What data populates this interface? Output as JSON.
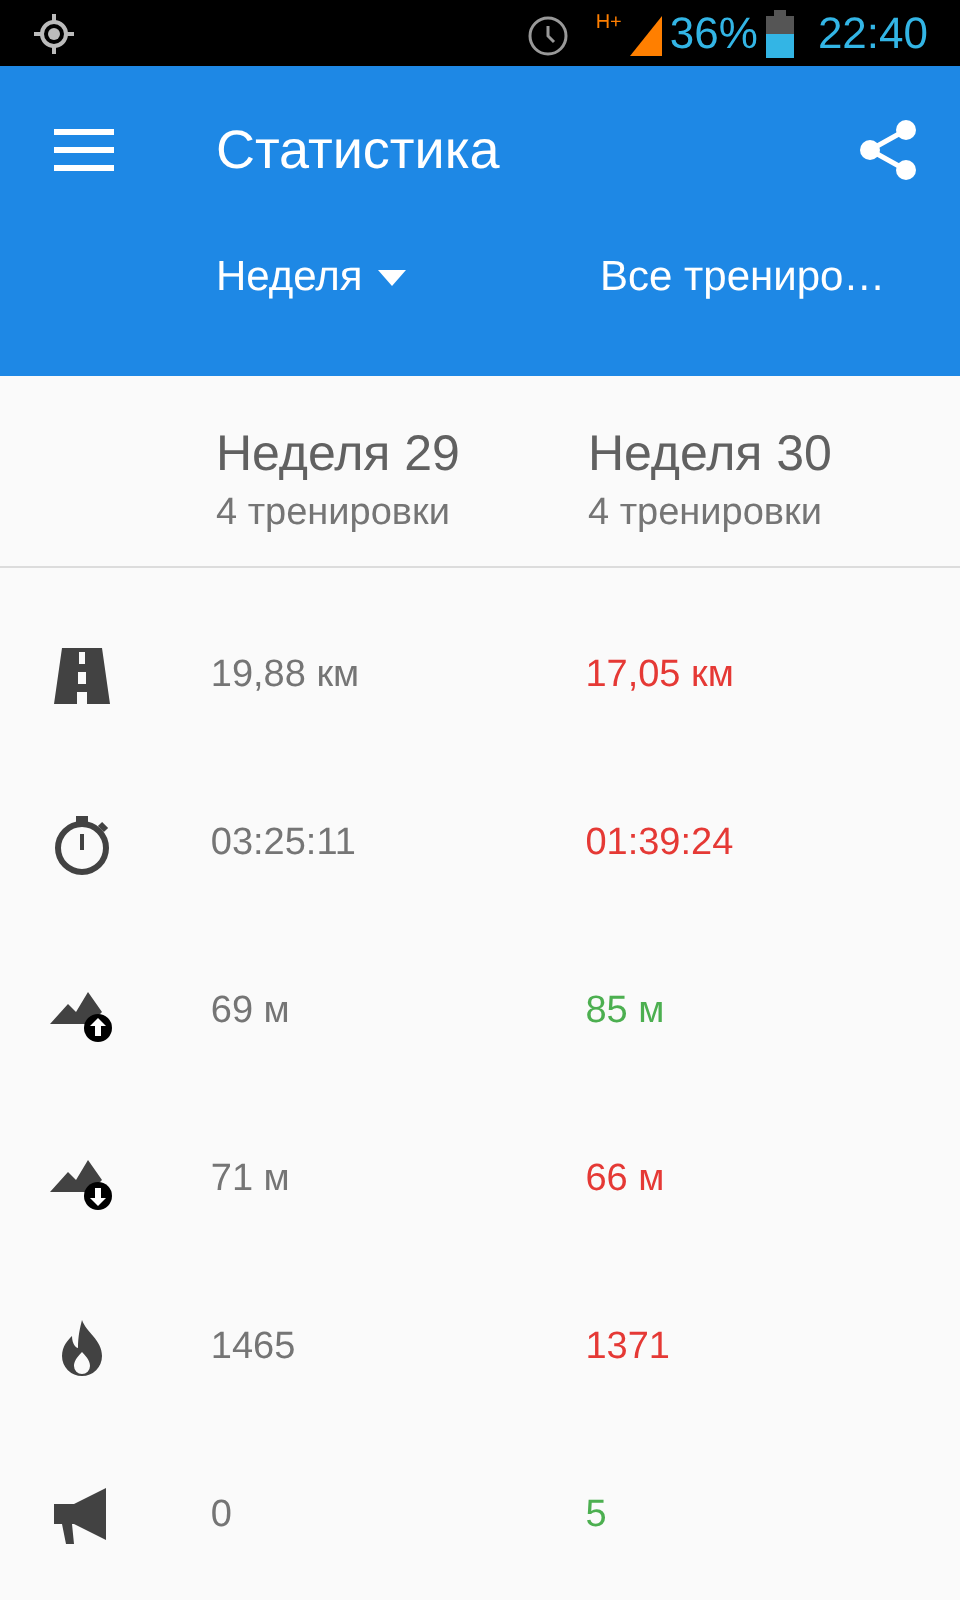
{
  "status_bar": {
    "battery_text": "36%",
    "network": "H+",
    "time": "22:40"
  },
  "app_bar": {
    "title": "Статистика"
  },
  "filters": [
    {
      "label": "Неделя",
      "dropdown": true
    },
    {
      "label": "Все трениро…",
      "dropdown": false
    }
  ],
  "columns": [
    {
      "title": "Неделя 29",
      "subtitle": "4 тренировки"
    },
    {
      "title": "Неделя 30",
      "subtitle": "4 тренировки"
    }
  ],
  "rows": [
    {
      "kind": "distance",
      "values": [
        {
          "text": "19,88 км",
          "color": "#757575"
        },
        {
          "text": "17,05 км",
          "color": "#e53935"
        }
      ]
    },
    {
      "kind": "duration",
      "values": [
        {
          "text": "03:25:11",
          "color": "#757575"
        },
        {
          "text": "01:39:24",
          "color": "#e53935"
        }
      ]
    },
    {
      "kind": "ascent",
      "values": [
        {
          "text": "69 м",
          "color": "#757575"
        },
        {
          "text": "85 м",
          "color": "#4caf50"
        }
      ]
    },
    {
      "kind": "descent",
      "values": [
        {
          "text": "71 м",
          "color": "#757575"
        },
        {
          "text": "66 м",
          "color": "#e53935"
        }
      ]
    },
    {
      "kind": "calories",
      "values": [
        {
          "text": "1465",
          "color": "#757575"
        },
        {
          "text": "1371",
          "color": "#e53935"
        }
      ]
    },
    {
      "kind": "cheers",
      "values": [
        {
          "text": "0",
          "color": "#757575"
        },
        {
          "text": "5",
          "color": "#4caf50"
        }
      ]
    }
  ]
}
